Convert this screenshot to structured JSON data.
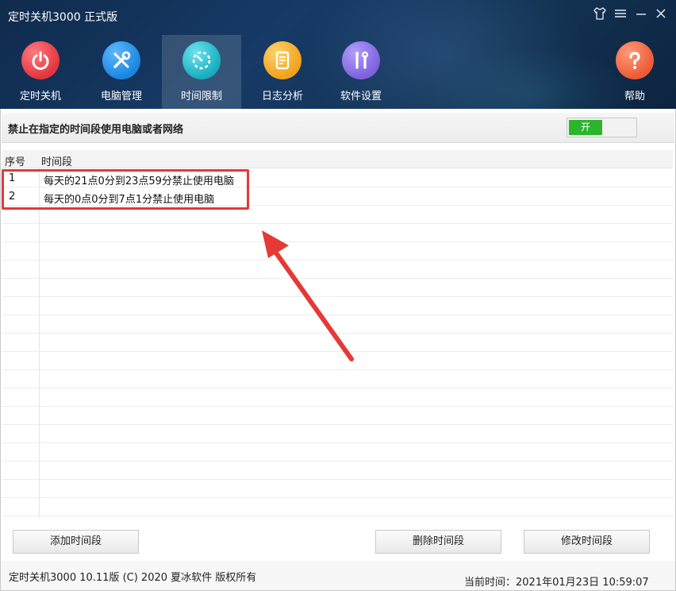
{
  "window": {
    "title": "定时关机3000 正式版",
    "controls": [
      "shirt-icon",
      "menu-icon",
      "minimize-icon",
      "close-icon"
    ]
  },
  "nav": {
    "items": [
      {
        "label": "定时关机",
        "icon": "power-icon",
        "color": "#e8444a"
      },
      {
        "label": "电脑管理",
        "icon": "tools-icon",
        "color": "#1e8fe6"
      },
      {
        "label": "时间限制",
        "icon": "clock-icon",
        "color": "#1fb6c9",
        "active": true
      },
      {
        "label": "日志分析",
        "icon": "log-icon",
        "color": "#f3a71c"
      },
      {
        "label": "软件设置",
        "icon": "settings-tools-icon",
        "color": "#8a6fe0"
      },
      {
        "label": "帮助",
        "icon": "help-icon",
        "color": "#f0603c"
      }
    ]
  },
  "section": {
    "title": "禁止在指定的时间段使用电脑或者网络",
    "toggle_label": "开",
    "toggle_on": true
  },
  "table": {
    "headers": [
      "序号",
      "时间段"
    ],
    "rows": [
      {
        "index": "1",
        "period": "每天的21点0分到23点59分禁止使用电脑"
      },
      {
        "index": "2",
        "period": "每天的0点0分到7点1分禁止使用电脑"
      }
    ]
  },
  "buttons": {
    "add": "添加时间段",
    "delete": "删除时间段",
    "edit": "修改时间段"
  },
  "footer": {
    "copyright": "定时关机3000 10.11版 (C) 2020  夏冰软件 版权所有",
    "current_time": "当前时间：2021年01月23日 10:59:07"
  },
  "colors": {
    "header_bg": "#153660",
    "toggle_on": "#2cb52c",
    "annotation": "#e53935"
  }
}
